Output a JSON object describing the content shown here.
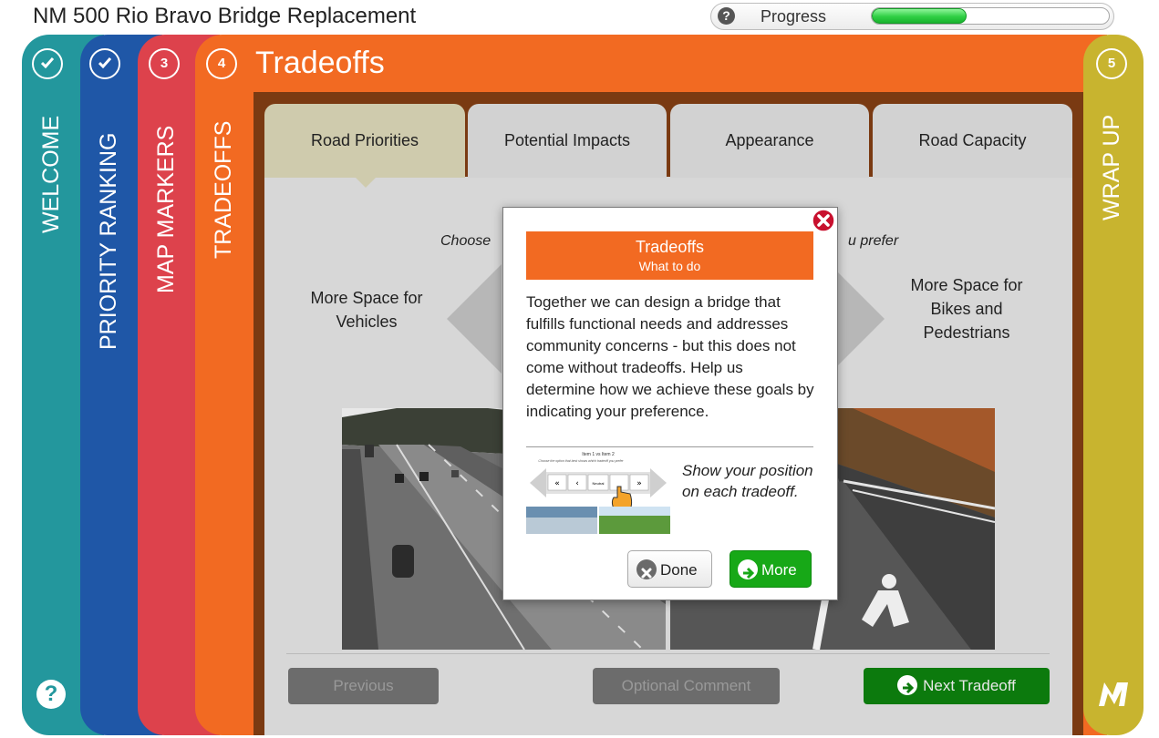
{
  "header": {
    "title": "NM 500 Rio Bravo Bridge Replacement",
    "progress_label": "Progress",
    "progress_fraction": 0.4
  },
  "sections": [
    {
      "badge": "✔",
      "label": "WELCOME",
      "color": "#23979d",
      "completed": true
    },
    {
      "badge": "✔",
      "label": "PRIORITY RANKING",
      "color": "#1f57a7",
      "completed": true
    },
    {
      "badge": "3",
      "label": "MAP MARKERS",
      "color": "#dd424c",
      "completed": false
    },
    {
      "badge": "4",
      "label": "TRADEOFFS",
      "color": "#f26a22",
      "completed": false
    },
    {
      "badge": "5",
      "label": "WRAP UP",
      "color": "#c8b42f",
      "completed": false
    }
  ],
  "main": {
    "title": "Tradeoffs",
    "tabs": [
      {
        "label": "Road Priorities",
        "active": true
      },
      {
        "label": "Potential Impacts",
        "active": false
      },
      {
        "label": "Appearance",
        "active": false
      },
      {
        "label": "Road Capacity",
        "active": false
      }
    ],
    "choose_text_left": "Choose",
    "choose_text_right": "u prefer",
    "left_option": "More Space for Vehicles",
    "right_option": "More Space for Bikes and Pedestrians",
    "buttons": {
      "previous": "Previous",
      "comment": "Optional Comment",
      "next": "Next Tradeoff"
    }
  },
  "modal": {
    "title": "Tradeoffs",
    "subtitle": "What to do",
    "body": "Together we can design a bridge that fulfills functional needs and addresses community concerns - but this does not come without tradeoffs. Help us determine how we achieve these goals by indicating your preference.",
    "hint": "Show your position on each tradeoff.",
    "mini_title": "Item 1 vs Item 2",
    "mini_sub": "Choose the option that best shows which tradeoff you prefer",
    "mini_neutral": "Neutral",
    "done_label": "Done",
    "more_label": "More"
  },
  "icons": {
    "help": "question-icon",
    "close": "close-icon",
    "logo": "metroquest-logo-icon"
  }
}
